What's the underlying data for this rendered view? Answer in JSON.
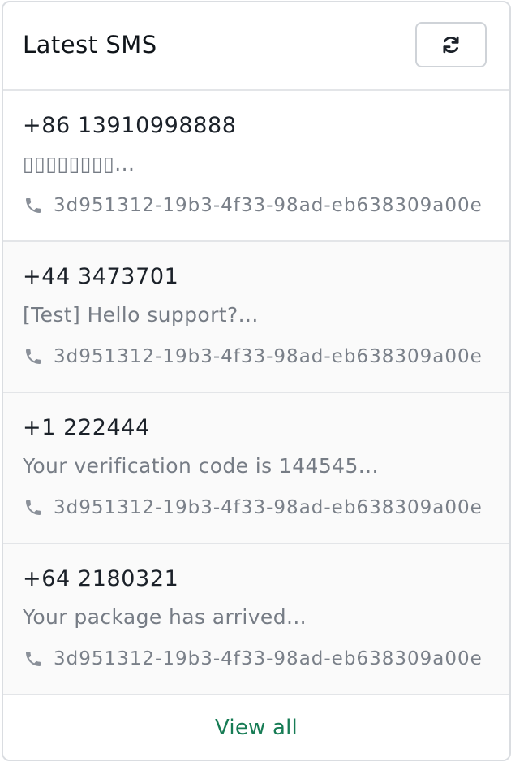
{
  "header": {
    "title": "Latest SMS",
    "refresh_icon": "refresh-icon"
  },
  "messages": [
    {
      "phone": "+86 13910998888",
      "text": "▯▯▯▯▯▯▯▯...",
      "device_icon": "phone-icon",
      "device_id": "3d951312-19b3-4f33-98ad-eb638309a00e"
    },
    {
      "phone": "+44 3473701",
      "text": "[Test] Hello support?...",
      "device_icon": "phone-icon",
      "device_id": "3d951312-19b3-4f33-98ad-eb638309a00e"
    },
    {
      "phone": "+1 222444",
      "text": "Your verification code is 144545...",
      "device_icon": "phone-icon",
      "device_id": "3d951312-19b3-4f33-98ad-eb638309a00e"
    },
    {
      "phone": "+64 2180321",
      "text": "Your package has arrived...",
      "device_icon": "phone-icon",
      "device_id": "3d951312-19b3-4f33-98ad-eb638309a00e"
    }
  ],
  "footer": {
    "view_all_label": "View all"
  },
  "colors": {
    "accent": "#177c55",
    "muted_text": "#767c85",
    "border": "#e3e5e8"
  }
}
